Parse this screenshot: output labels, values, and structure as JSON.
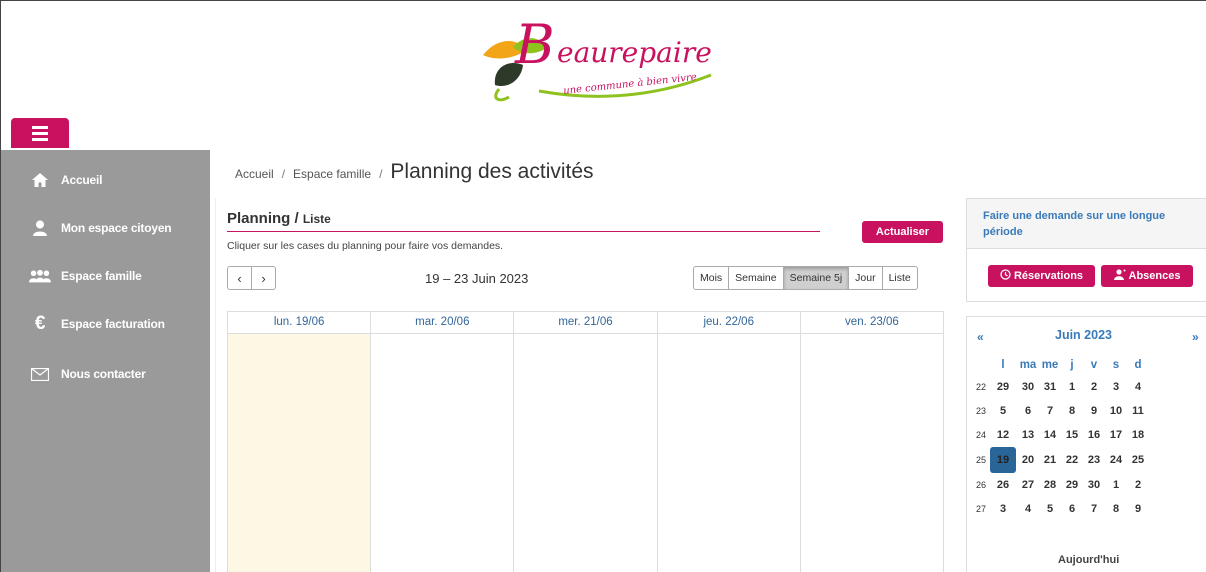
{
  "header": {
    "logo_text": "Beaurepaire",
    "logo_tagline": "une commune à bien vivre",
    "brand_color": "#c8125f"
  },
  "sidebar": {
    "items": [
      {
        "label": "Accueil",
        "icon": "home-icon"
      },
      {
        "label": "Mon espace citoyen",
        "icon": "person-icon"
      },
      {
        "label": "Espace famille",
        "icon": "family-icon"
      },
      {
        "label": "Espace facturation",
        "icon": "euro-icon"
      },
      {
        "label": "Nous contacter",
        "icon": "envelope-icon"
      }
    ]
  },
  "breadcrumb": {
    "items": [
      "Accueil",
      "Espace famille"
    ],
    "separator": "/",
    "current": "Planning des activités"
  },
  "planning": {
    "title": "Planning /",
    "subtitle": "Liste",
    "hint": "Cliquer sur les cases du planning pour faire vos demandes.",
    "refresh_label": "Actualiser",
    "prev_label": "‹",
    "next_label": "›",
    "date_range": "19 – 23 Juin 2023",
    "views": [
      {
        "label": "Mois",
        "active": false
      },
      {
        "label": "Semaine",
        "active": false
      },
      {
        "label": "Semaine 5j",
        "active": true
      },
      {
        "label": "Jour",
        "active": false
      },
      {
        "label": "Liste",
        "active": false
      }
    ],
    "days": [
      "lun. 19/06",
      "mar. 20/06",
      "mer. 21/06",
      "jeu. 22/06",
      "ven. 23/06"
    ],
    "today_index": 0
  },
  "request_panel": {
    "title": "Faire une demande sur une longue période",
    "reservations_label": "Réservations",
    "absences_label": "Absences"
  },
  "mini_calendar": {
    "prev": "«",
    "next": "»",
    "title": "Juin 2023",
    "weekdays": [
      "l",
      "ma",
      "me",
      "j",
      "v",
      "s",
      "d"
    ],
    "weeks": [
      {
        "num": "22",
        "days": [
          "29",
          "30",
          "31",
          "1",
          "2",
          "3",
          "4"
        ]
      },
      {
        "num": "23",
        "days": [
          "5",
          "6",
          "7",
          "8",
          "9",
          "10",
          "11"
        ]
      },
      {
        "num": "24",
        "days": [
          "12",
          "13",
          "14",
          "15",
          "16",
          "17",
          "18"
        ]
      },
      {
        "num": "25",
        "days": [
          "19",
          "20",
          "21",
          "22",
          "23",
          "24",
          "25"
        ]
      },
      {
        "num": "26",
        "days": [
          "26",
          "27",
          "28",
          "29",
          "30",
          "1",
          "2"
        ]
      },
      {
        "num": "27",
        "days": [
          "3",
          "4",
          "5",
          "6",
          "7",
          "8",
          "9"
        ]
      }
    ],
    "selected": "19",
    "today_label": "Aujourd'hui"
  }
}
